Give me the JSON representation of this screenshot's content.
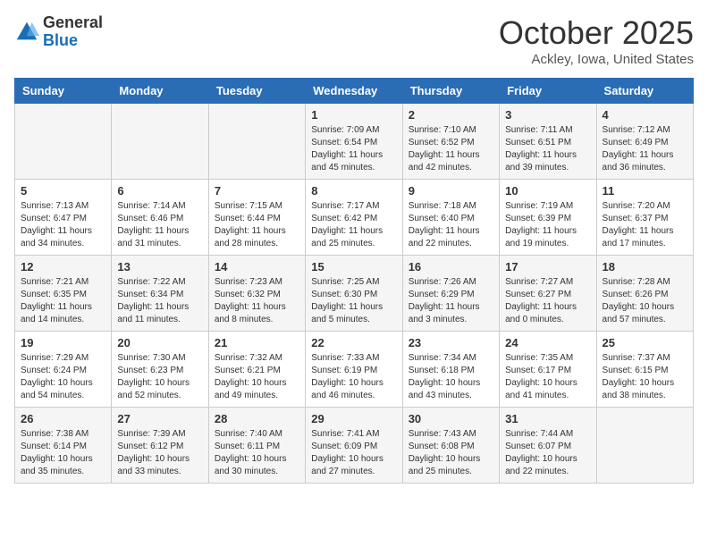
{
  "header": {
    "logo_general": "General",
    "logo_blue": "Blue",
    "month_title": "October 2025",
    "location": "Ackley, Iowa, United States"
  },
  "days_of_week": [
    "Sunday",
    "Monday",
    "Tuesday",
    "Wednesday",
    "Thursday",
    "Friday",
    "Saturday"
  ],
  "weeks": [
    [
      {
        "day": "",
        "info": ""
      },
      {
        "day": "",
        "info": ""
      },
      {
        "day": "",
        "info": ""
      },
      {
        "day": "1",
        "info": "Sunrise: 7:09 AM\nSunset: 6:54 PM\nDaylight: 11 hours and 45 minutes."
      },
      {
        "day": "2",
        "info": "Sunrise: 7:10 AM\nSunset: 6:52 PM\nDaylight: 11 hours and 42 minutes."
      },
      {
        "day": "3",
        "info": "Sunrise: 7:11 AM\nSunset: 6:51 PM\nDaylight: 11 hours and 39 minutes."
      },
      {
        "day": "4",
        "info": "Sunrise: 7:12 AM\nSunset: 6:49 PM\nDaylight: 11 hours and 36 minutes."
      }
    ],
    [
      {
        "day": "5",
        "info": "Sunrise: 7:13 AM\nSunset: 6:47 PM\nDaylight: 11 hours and 34 minutes."
      },
      {
        "day": "6",
        "info": "Sunrise: 7:14 AM\nSunset: 6:46 PM\nDaylight: 11 hours and 31 minutes."
      },
      {
        "day": "7",
        "info": "Sunrise: 7:15 AM\nSunset: 6:44 PM\nDaylight: 11 hours and 28 minutes."
      },
      {
        "day": "8",
        "info": "Sunrise: 7:17 AM\nSunset: 6:42 PM\nDaylight: 11 hours and 25 minutes."
      },
      {
        "day": "9",
        "info": "Sunrise: 7:18 AM\nSunset: 6:40 PM\nDaylight: 11 hours and 22 minutes."
      },
      {
        "day": "10",
        "info": "Sunrise: 7:19 AM\nSunset: 6:39 PM\nDaylight: 11 hours and 19 minutes."
      },
      {
        "day": "11",
        "info": "Sunrise: 7:20 AM\nSunset: 6:37 PM\nDaylight: 11 hours and 17 minutes."
      }
    ],
    [
      {
        "day": "12",
        "info": "Sunrise: 7:21 AM\nSunset: 6:35 PM\nDaylight: 11 hours and 14 minutes."
      },
      {
        "day": "13",
        "info": "Sunrise: 7:22 AM\nSunset: 6:34 PM\nDaylight: 11 hours and 11 minutes."
      },
      {
        "day": "14",
        "info": "Sunrise: 7:23 AM\nSunset: 6:32 PM\nDaylight: 11 hours and 8 minutes."
      },
      {
        "day": "15",
        "info": "Sunrise: 7:25 AM\nSunset: 6:30 PM\nDaylight: 11 hours and 5 minutes."
      },
      {
        "day": "16",
        "info": "Sunrise: 7:26 AM\nSunset: 6:29 PM\nDaylight: 11 hours and 3 minutes."
      },
      {
        "day": "17",
        "info": "Sunrise: 7:27 AM\nSunset: 6:27 PM\nDaylight: 11 hours and 0 minutes."
      },
      {
        "day": "18",
        "info": "Sunrise: 7:28 AM\nSunset: 6:26 PM\nDaylight: 10 hours and 57 minutes."
      }
    ],
    [
      {
        "day": "19",
        "info": "Sunrise: 7:29 AM\nSunset: 6:24 PM\nDaylight: 10 hours and 54 minutes."
      },
      {
        "day": "20",
        "info": "Sunrise: 7:30 AM\nSunset: 6:23 PM\nDaylight: 10 hours and 52 minutes."
      },
      {
        "day": "21",
        "info": "Sunrise: 7:32 AM\nSunset: 6:21 PM\nDaylight: 10 hours and 49 minutes."
      },
      {
        "day": "22",
        "info": "Sunrise: 7:33 AM\nSunset: 6:19 PM\nDaylight: 10 hours and 46 minutes."
      },
      {
        "day": "23",
        "info": "Sunrise: 7:34 AM\nSunset: 6:18 PM\nDaylight: 10 hours and 43 minutes."
      },
      {
        "day": "24",
        "info": "Sunrise: 7:35 AM\nSunset: 6:17 PM\nDaylight: 10 hours and 41 minutes."
      },
      {
        "day": "25",
        "info": "Sunrise: 7:37 AM\nSunset: 6:15 PM\nDaylight: 10 hours and 38 minutes."
      }
    ],
    [
      {
        "day": "26",
        "info": "Sunrise: 7:38 AM\nSunset: 6:14 PM\nDaylight: 10 hours and 35 minutes."
      },
      {
        "day": "27",
        "info": "Sunrise: 7:39 AM\nSunset: 6:12 PM\nDaylight: 10 hours and 33 minutes."
      },
      {
        "day": "28",
        "info": "Sunrise: 7:40 AM\nSunset: 6:11 PM\nDaylight: 10 hours and 30 minutes."
      },
      {
        "day": "29",
        "info": "Sunrise: 7:41 AM\nSunset: 6:09 PM\nDaylight: 10 hours and 27 minutes."
      },
      {
        "day": "30",
        "info": "Sunrise: 7:43 AM\nSunset: 6:08 PM\nDaylight: 10 hours and 25 minutes."
      },
      {
        "day": "31",
        "info": "Sunrise: 7:44 AM\nSunset: 6:07 PM\nDaylight: 10 hours and 22 minutes."
      },
      {
        "day": "",
        "info": ""
      }
    ]
  ]
}
